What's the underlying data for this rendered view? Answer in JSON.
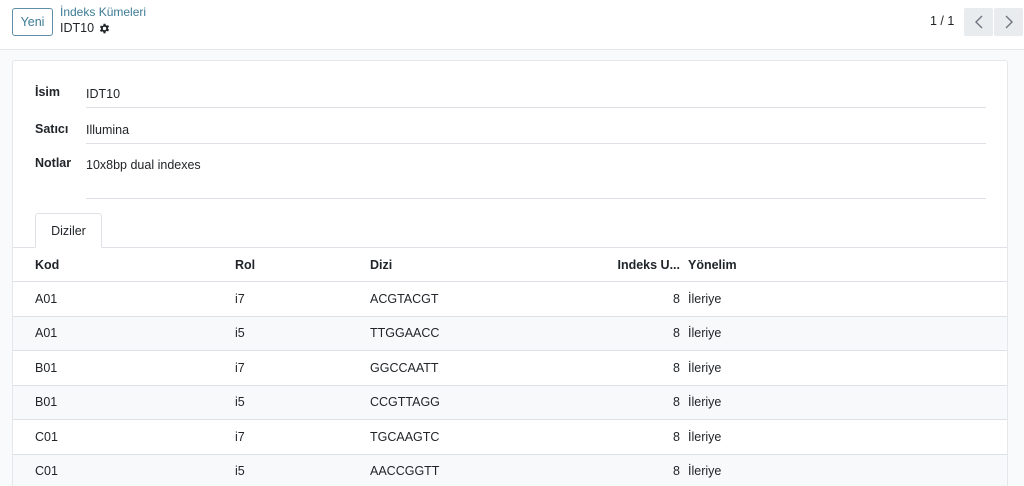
{
  "control_panel": {
    "new_button": "Yeni",
    "breadcrumb_parent": "İndeks Kümeleri",
    "breadcrumb_current": "IDT10",
    "pager_value": "1 / 1"
  },
  "form": {
    "fields": [
      {
        "label": "İsim",
        "value": "IDT10"
      },
      {
        "label": "Satıcı",
        "value": "Illumina"
      },
      {
        "label": "Notlar",
        "value": "10x8bp dual indexes"
      }
    ]
  },
  "tabs": [
    {
      "label": "Diziler",
      "active": true
    }
  ],
  "table": {
    "headers": [
      "Kod",
      "Rol",
      "Dizi",
      "Indeks U...",
      "Yönelim"
    ],
    "rows": [
      {
        "kod": "A01",
        "rol": "i7",
        "dizi": "ACGTACGT",
        "uzunluk": "8",
        "yonelim": "İleriye"
      },
      {
        "kod": "A01",
        "rol": "i5",
        "dizi": "TTGGAACC",
        "uzunluk": "8",
        "yonelim": "İleriye"
      },
      {
        "kod": "B01",
        "rol": "i7",
        "dizi": "GGCCAATT",
        "uzunluk": "8",
        "yonelim": "İleriye"
      },
      {
        "kod": "B01",
        "rol": "i5",
        "dizi": "CCGTTAGG",
        "uzunluk": "8",
        "yonelim": "İleriye"
      },
      {
        "kod": "C01",
        "rol": "i7",
        "dizi": "TGCAAGTC",
        "uzunluk": "8",
        "yonelim": "İleriye"
      },
      {
        "kod": "C01",
        "rol": "i5",
        "dizi": "AACCGGTT",
        "uzunluk": "8",
        "yonelim": "İleriye"
      }
    ]
  },
  "colors": {
    "accent": "#3d7b94",
    "row_alt": "#f8f9fa",
    "border": "#dee2e6"
  }
}
